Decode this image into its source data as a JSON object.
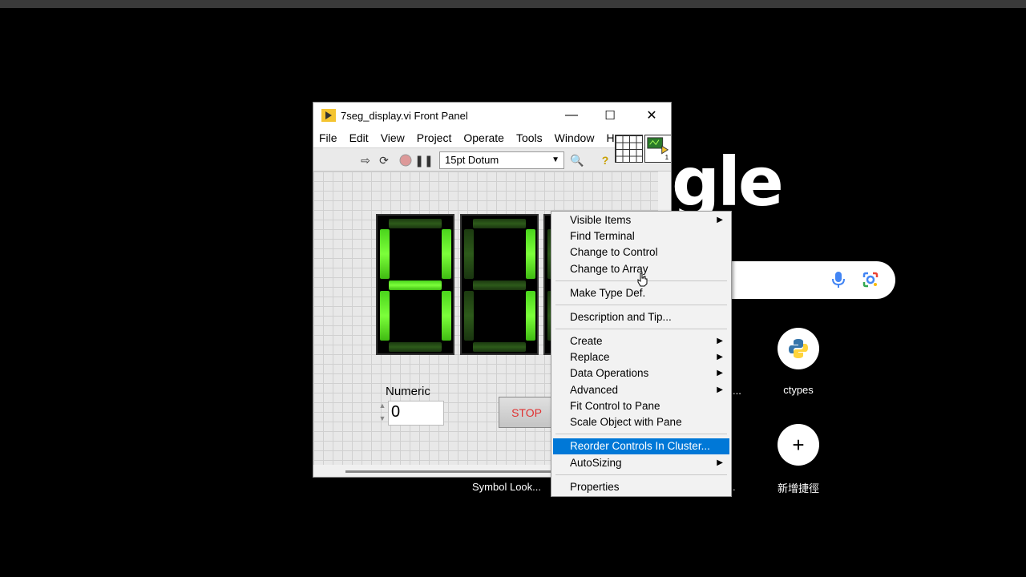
{
  "background": {
    "logo_text": "gle",
    "shortcuts": [
      {
        "label": "ctypes",
        "icon": "python-icon"
      },
      {
        "label": "新增捷徑",
        "icon": "plus-icon"
      }
    ],
    "partial_labels": [
      "...",
      "."
    ],
    "symbol_label": "Symbol Look..."
  },
  "window": {
    "title": "7seg_display.vi Front Panel",
    "minimize": "—",
    "maximize": "☐",
    "close": "✕"
  },
  "menubar": {
    "items": [
      "File",
      "Edit",
      "View",
      "Project",
      "Operate",
      "Tools",
      "Window",
      "H"
    ]
  },
  "toolbar": {
    "font": "15pt Dotum"
  },
  "panel": {
    "numeric_label": "Numeric",
    "numeric_value": "0",
    "stop_label": "STOP"
  },
  "context_menu": {
    "items": [
      {
        "label": "Visible Items",
        "submenu": true
      },
      {
        "label": "Find Terminal",
        "submenu": false
      },
      {
        "label": "Change to Control",
        "submenu": false
      },
      {
        "label": "Change to Array",
        "submenu": false
      },
      {
        "label": "Make Type Def.",
        "submenu": false
      },
      {
        "label": "Description and Tip...",
        "submenu": false
      },
      {
        "label": "Create",
        "submenu": true
      },
      {
        "label": "Replace",
        "submenu": true
      },
      {
        "label": "Data Operations",
        "submenu": true
      },
      {
        "label": "Advanced",
        "submenu": true
      },
      {
        "label": "Fit Control to Pane",
        "submenu": false
      },
      {
        "label": "Scale Object with Pane",
        "submenu": false
      },
      {
        "label": "Reorder Controls In Cluster...",
        "submenu": false,
        "highlighted": true
      },
      {
        "label": "AutoSizing",
        "submenu": true
      },
      {
        "label": "Properties",
        "submenu": false
      }
    ],
    "submenu_arrow": "▶"
  },
  "colors": {
    "highlight": "#0078d7",
    "segment_on": "#6cf03a",
    "segment_off": "#2d5a1a",
    "stop_text": "#e03030"
  }
}
